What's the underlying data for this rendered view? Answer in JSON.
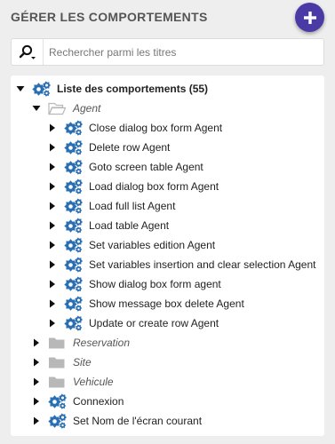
{
  "header": {
    "title": "GÉRER LES COMPORTEMENTS"
  },
  "search": {
    "placeholder": "Rechercher parmi les titres"
  },
  "colors": {
    "accent": "#4a3aa5",
    "gear_icon": "#2b6fb3",
    "folder_icon": "#b8b8b8"
  },
  "tree": {
    "root": {
      "label": "Liste des comportements (55)",
      "icon": "gears-icon",
      "expanded": true
    },
    "agent_folder": {
      "label": "Agent",
      "icon": "folder-open-icon",
      "expanded": true
    },
    "agent_items": [
      "Close dialog box form Agent",
      "Delete row Agent",
      "Goto screen table Agent",
      "Load dialog box form Agent",
      "Load full list Agent",
      "Load table Agent",
      "Set variables edition Agent",
      "Set variables insertion and clear selection Agent",
      "Show dialog box form agent",
      "Show message box delete Agent",
      "Update or create row Agent"
    ],
    "folders": [
      "Reservation",
      "Site",
      "Vehicule"
    ],
    "root_items": [
      "Connexion",
      "Set Nom de l'écran courant"
    ]
  }
}
